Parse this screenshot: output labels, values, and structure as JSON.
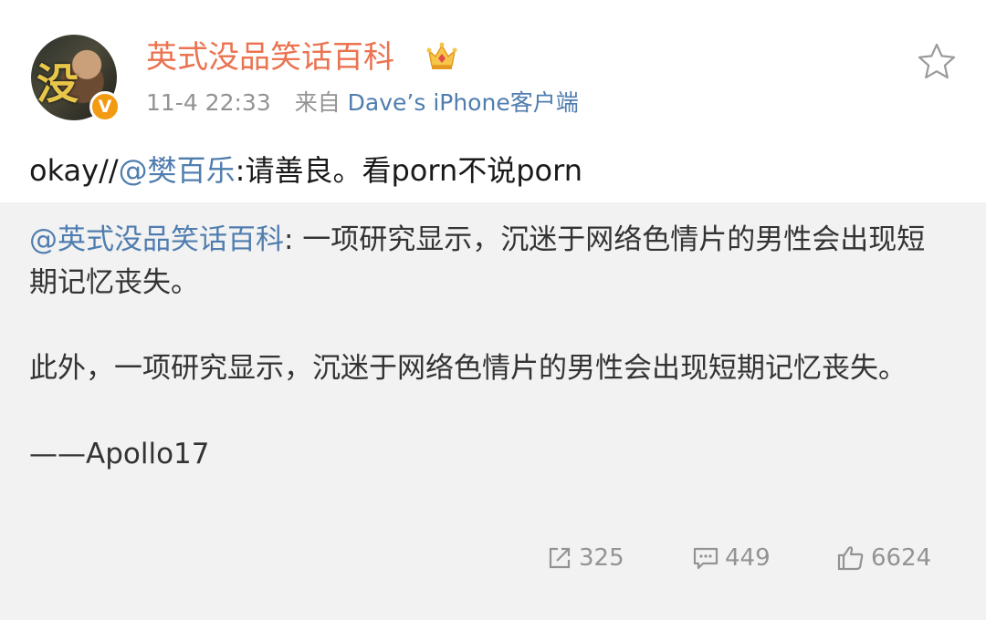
{
  "post": {
    "username": "英式没品笑话百科",
    "time": "11-4 22:33",
    "source_prefix": "来自",
    "device": "Dave’s iPhone客户端",
    "avatar_text": "没",
    "verified_badge": "V",
    "body_prefix": "okay//",
    "body_mention": "@樊百乐",
    "body_rest": ":请善良。看porn不说porn"
  },
  "retweet": {
    "mention": "@英式没品笑话百科",
    "line1_rest": ": 一项研究显示，沉迷于网络色情片的男性会出现短期记忆丧失。",
    "para2": "此外，一项研究显示，沉迷于网络色情片的男性会出现短期记忆丧失。",
    "signature": "——Apollo17"
  },
  "actions": {
    "repost_count": "325",
    "comment_count": "449",
    "like_count": "6624"
  },
  "icons": {
    "star": "star-outline-icon",
    "crown": "crown-icon",
    "repost": "repost-icon",
    "comment": "comment-icon",
    "like": "thumbs-up-icon"
  },
  "colors": {
    "username": "#eb7350",
    "link": "#507daf",
    "meta": "#939393",
    "retweet_bg": "#f2f2f2",
    "badge": "#f29a12"
  }
}
